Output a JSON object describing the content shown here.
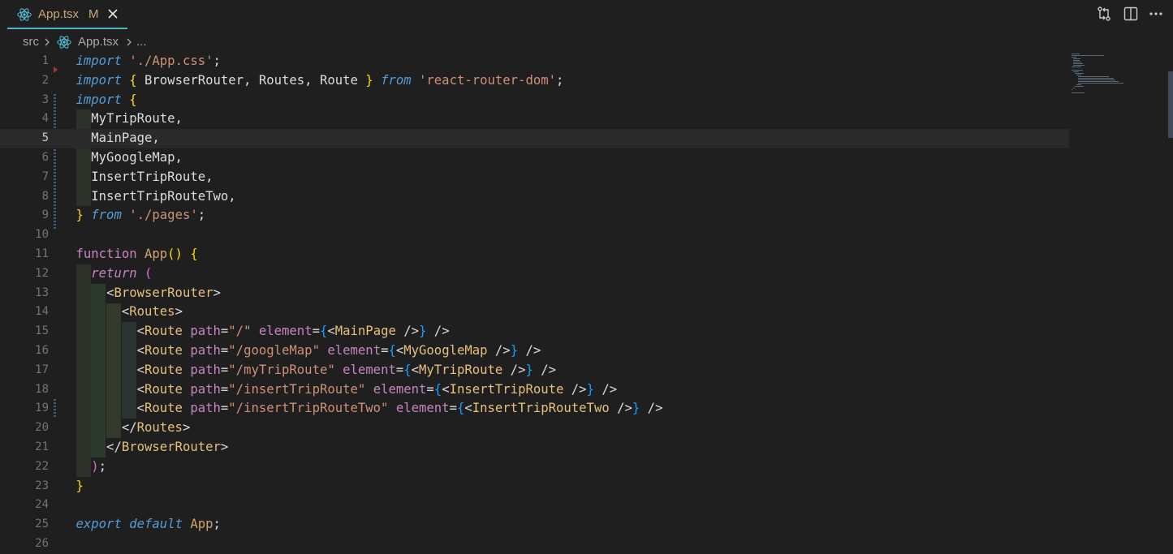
{
  "tab": {
    "filename": "App.tsx",
    "modified": "M"
  },
  "breadcrumb": {
    "folder": "src",
    "file": "App.tsx",
    "more": "..."
  },
  "editor": {
    "current_line": 5,
    "lines": [
      {
        "n": "1",
        "t": [
          {
            "c": "kw",
            "v": "import"
          },
          {
            "c": "id",
            "v": " "
          },
          {
            "c": "str",
            "v": "'./App.css'"
          },
          {
            "c": "id",
            "v": ";"
          }
        ]
      },
      {
        "n": "2",
        "t": [
          {
            "c": "kw",
            "v": "import"
          },
          {
            "c": "id",
            "v": " "
          },
          {
            "c": "br1",
            "v": "{"
          },
          {
            "c": "id",
            "v": " BrowserRouter, Routes, Route "
          },
          {
            "c": "br1",
            "v": "}"
          },
          {
            "c": "id",
            "v": " "
          },
          {
            "c": "kw",
            "v": "from"
          },
          {
            "c": "id",
            "v": " "
          },
          {
            "c": "str",
            "v": "'react-router-dom'"
          },
          {
            "c": "id",
            "v": ";"
          }
        ]
      },
      {
        "n": "3",
        "t": [
          {
            "c": "kw",
            "v": "import"
          },
          {
            "c": "id",
            "v": " "
          },
          {
            "c": "br1",
            "v": "{"
          }
        ]
      },
      {
        "n": "4",
        "t": [
          {
            "c": "id",
            "v": "  MyTripRoute,"
          }
        ]
      },
      {
        "n": "5",
        "t": [
          {
            "c": "id",
            "v": "  MainPage,"
          }
        ]
      },
      {
        "n": "6",
        "t": [
          {
            "c": "id",
            "v": "  MyGoogleMap,"
          }
        ]
      },
      {
        "n": "7",
        "t": [
          {
            "c": "id",
            "v": "  InsertTripRoute,"
          }
        ]
      },
      {
        "n": "8",
        "t": [
          {
            "c": "id",
            "v": "  InsertTripRouteTwo,"
          }
        ]
      },
      {
        "n": "9",
        "t": [
          {
            "c": "br1",
            "v": "}"
          },
          {
            "c": "id",
            "v": " "
          },
          {
            "c": "kw",
            "v": "from"
          },
          {
            "c": "id",
            "v": " "
          },
          {
            "c": "str",
            "v": "'./pages'"
          },
          {
            "c": "id",
            "v": ";"
          }
        ]
      },
      {
        "n": "10",
        "t": []
      },
      {
        "n": "11",
        "t": [
          {
            "c": "fn",
            "v": "function"
          },
          {
            "c": "id",
            "v": " "
          },
          {
            "c": "fnname",
            "v": "App"
          },
          {
            "c": "br1",
            "v": "()"
          },
          {
            "c": "id",
            "v": " "
          },
          {
            "c": "br1",
            "v": "{"
          }
        ]
      },
      {
        "n": "12",
        "t": [
          {
            "c": "id",
            "v": "  "
          },
          {
            "c": "kwp",
            "v": "return"
          },
          {
            "c": "id",
            "v": " "
          },
          {
            "c": "br2",
            "v": "("
          }
        ]
      },
      {
        "n": "13",
        "t": [
          {
            "c": "id",
            "v": "    "
          },
          {
            "c": "id",
            "v": "<"
          },
          {
            "c": "tag",
            "v": "BrowserRouter"
          },
          {
            "c": "id",
            "v": ">"
          }
        ]
      },
      {
        "n": "14",
        "t": [
          {
            "c": "id",
            "v": "      <"
          },
          {
            "c": "tag",
            "v": "Routes"
          },
          {
            "c": "id",
            "v": ">"
          }
        ]
      },
      {
        "n": "15",
        "t": [
          {
            "c": "id",
            "v": "        <"
          },
          {
            "c": "tag",
            "v": "Route"
          },
          {
            "c": "id",
            "v": " "
          },
          {
            "c": "attr",
            "v": "path"
          },
          {
            "c": "id",
            "v": "="
          },
          {
            "c": "str",
            "v": "\"/\""
          },
          {
            "c": "id",
            "v": " "
          },
          {
            "c": "attr",
            "v": "element"
          },
          {
            "c": "id",
            "v": "="
          },
          {
            "c": "br3",
            "v": "{"
          },
          {
            "c": "id",
            "v": "<"
          },
          {
            "c": "tag",
            "v": "MainPage"
          },
          {
            "c": "id",
            "v": " />"
          },
          {
            "c": "br3",
            "v": "}"
          },
          {
            "c": "id",
            "v": " />"
          }
        ]
      },
      {
        "n": "16",
        "t": [
          {
            "c": "id",
            "v": "        <"
          },
          {
            "c": "tag",
            "v": "Route"
          },
          {
            "c": "id",
            "v": " "
          },
          {
            "c": "attr",
            "v": "path"
          },
          {
            "c": "id",
            "v": "="
          },
          {
            "c": "str",
            "v": "\"/googleMap\""
          },
          {
            "c": "id",
            "v": " "
          },
          {
            "c": "attr",
            "v": "element"
          },
          {
            "c": "id",
            "v": "="
          },
          {
            "c": "br3",
            "v": "{"
          },
          {
            "c": "id",
            "v": "<"
          },
          {
            "c": "tag",
            "v": "MyGoogleMap"
          },
          {
            "c": "id",
            "v": " />"
          },
          {
            "c": "br3",
            "v": "}"
          },
          {
            "c": "id",
            "v": " />"
          }
        ]
      },
      {
        "n": "17",
        "t": [
          {
            "c": "id",
            "v": "        <"
          },
          {
            "c": "tag",
            "v": "Route"
          },
          {
            "c": "id",
            "v": " "
          },
          {
            "c": "attr",
            "v": "path"
          },
          {
            "c": "id",
            "v": "="
          },
          {
            "c": "str",
            "v": "\"/myTripRoute\""
          },
          {
            "c": "id",
            "v": " "
          },
          {
            "c": "attr",
            "v": "element"
          },
          {
            "c": "id",
            "v": "="
          },
          {
            "c": "br3",
            "v": "{"
          },
          {
            "c": "id",
            "v": "<"
          },
          {
            "c": "tag",
            "v": "MyTripRoute"
          },
          {
            "c": "id",
            "v": " />"
          },
          {
            "c": "br3",
            "v": "}"
          },
          {
            "c": "id",
            "v": " />"
          }
        ]
      },
      {
        "n": "18",
        "t": [
          {
            "c": "id",
            "v": "        <"
          },
          {
            "c": "tag",
            "v": "Route"
          },
          {
            "c": "id",
            "v": " "
          },
          {
            "c": "attr",
            "v": "path"
          },
          {
            "c": "id",
            "v": "="
          },
          {
            "c": "str",
            "v": "\"/insertTripRoute\""
          },
          {
            "c": "id",
            "v": " "
          },
          {
            "c": "attr",
            "v": "element"
          },
          {
            "c": "id",
            "v": "="
          },
          {
            "c": "br3",
            "v": "{"
          },
          {
            "c": "id",
            "v": "<"
          },
          {
            "c": "tag",
            "v": "InsertTripRoute"
          },
          {
            "c": "id",
            "v": " />"
          },
          {
            "c": "br3",
            "v": "}"
          },
          {
            "c": "id",
            "v": " />"
          }
        ]
      },
      {
        "n": "19",
        "t": [
          {
            "c": "id",
            "v": "        <"
          },
          {
            "c": "tag",
            "v": "Route"
          },
          {
            "c": "id",
            "v": " "
          },
          {
            "c": "attr",
            "v": "path"
          },
          {
            "c": "id",
            "v": "="
          },
          {
            "c": "str",
            "v": "\"/insertTripRouteTwo\""
          },
          {
            "c": "id",
            "v": " "
          },
          {
            "c": "attr",
            "v": "element"
          },
          {
            "c": "id",
            "v": "="
          },
          {
            "c": "br3",
            "v": "{"
          },
          {
            "c": "id",
            "v": "<"
          },
          {
            "c": "tag",
            "v": "InsertTripRouteTwo"
          },
          {
            "c": "id",
            "v": " />"
          },
          {
            "c": "br3",
            "v": "}"
          },
          {
            "c": "id",
            "v": " />"
          }
        ]
      },
      {
        "n": "20",
        "t": [
          {
            "c": "id",
            "v": "      </"
          },
          {
            "c": "tag",
            "v": "Routes"
          },
          {
            "c": "id",
            "v": ">"
          }
        ]
      },
      {
        "n": "21",
        "t": [
          {
            "c": "id",
            "v": "    </"
          },
          {
            "c": "tag",
            "v": "BrowserRouter"
          },
          {
            "c": "id",
            "v": ">"
          }
        ]
      },
      {
        "n": "22",
        "t": [
          {
            "c": "id",
            "v": "  "
          },
          {
            "c": "br2",
            "v": ")"
          },
          {
            "c": "id",
            "v": ";"
          }
        ]
      },
      {
        "n": "23",
        "t": [
          {
            "c": "br1",
            "v": "}"
          }
        ]
      },
      {
        "n": "24",
        "t": []
      },
      {
        "n": "25",
        "t": [
          {
            "c": "kw",
            "v": "export"
          },
          {
            "c": "id",
            "v": " "
          },
          {
            "c": "kw",
            "v": "default"
          },
          {
            "c": "id",
            "v": " "
          },
          {
            "c": "fnname",
            "v": "App"
          },
          {
            "c": "id",
            "v": ";"
          }
        ]
      },
      {
        "n": "26",
        "t": []
      }
    ]
  },
  "colors": {
    "accent": "#4fb6c7",
    "modified": "#c8a874",
    "react": "#58c4dc"
  }
}
